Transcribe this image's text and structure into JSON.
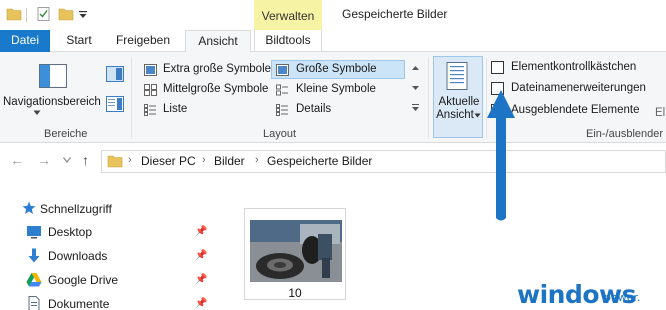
{
  "titlebar": {
    "context_tab": "Verwalten",
    "window_title": "Gespeicherte Bilder"
  },
  "tabs": {
    "file": "Datei",
    "start": "Start",
    "share": "Freigeben",
    "view": "Ansicht",
    "picture_tools": "Bildtools"
  },
  "ribbon": {
    "panes_group": {
      "navigation_pane": "Navigationsbereich",
      "label": "Bereiche"
    },
    "layout_group": {
      "items": [
        "Extra große Symbole",
        "Große Symbole",
        "Mittelgroße Symbole",
        "Kleine Symbole",
        "Liste",
        "Details"
      ],
      "selected": "Große Symbole",
      "label": "Layout"
    },
    "current_view": {
      "line1": "Aktuelle",
      "line2": "Ansicht"
    },
    "show_hide_group": {
      "item_checkboxes": "Elementkontrollkästchen",
      "file_extensions": "Dateinamenerweiterungen",
      "hidden_items": "Ausgeblendete Elemente",
      "label": "Ein-/ausblender",
      "cut_off": "El"
    }
  },
  "address": {
    "crumbs": [
      "Dieser PC",
      "Bilder",
      "Gespeicherte Bilder"
    ]
  },
  "nav_pane": {
    "quick_access": "Schnellzugriff",
    "items": [
      "Desktop",
      "Downloads",
      "Google Drive",
      "Dokumente"
    ]
  },
  "content": {
    "file_name": "10"
  },
  "watermark": {
    "brand": "windows",
    "suffix": "power."
  },
  "colors": {
    "file_tab": "#1979ca",
    "context_tab": "#f7f3a4",
    "arrow": "#1d74c4",
    "selection": "#cce4f7"
  }
}
